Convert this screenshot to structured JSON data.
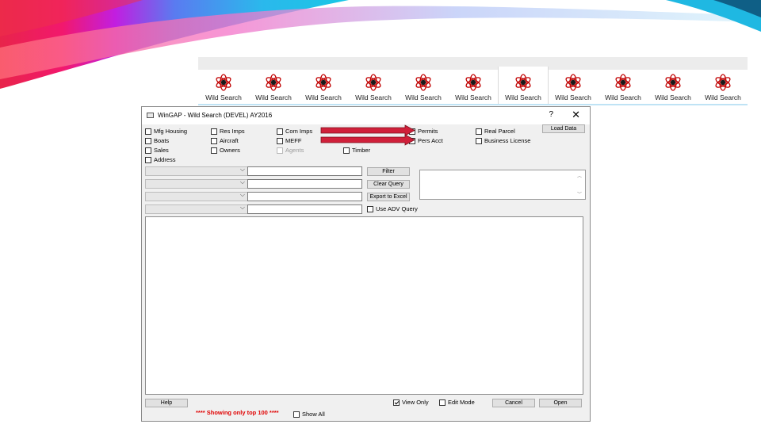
{
  "ribbon": {
    "tabs": [
      {
        "label": "Wild Search",
        "icon": "atom-icon"
      },
      {
        "label": "Wild Search",
        "icon": "atom-icon"
      },
      {
        "label": "Wild Search",
        "icon": "atom-icon"
      },
      {
        "label": "Wild Search",
        "icon": "atom-icon"
      },
      {
        "label": "Wild Search",
        "icon": "atom-icon"
      },
      {
        "label": "Wild Search",
        "icon": "atom-icon"
      },
      {
        "label": "Wild Search",
        "icon": "atom-icon",
        "active": true
      },
      {
        "label": "Wild Search",
        "icon": "atom-icon"
      },
      {
        "label": "Wild Search",
        "icon": "atom-icon"
      },
      {
        "label": "Wild Search",
        "icon": "atom-icon"
      },
      {
        "label": "Wild Search",
        "icon": "atom-icon"
      }
    ]
  },
  "window": {
    "title": "WinGAP - Wild Search (DEVEL) AY2016",
    "help_glyph": "?",
    "close_glyph": "✕",
    "checkboxes": {
      "mfg_housing": {
        "label": "Mfg Housing",
        "checked": false
      },
      "boats": {
        "label": "Boats",
        "checked": false
      },
      "sales": {
        "label": "Sales",
        "checked": false
      },
      "address": {
        "label": "Address",
        "checked": false
      },
      "res_imps": {
        "label": "Res Imps",
        "checked": false
      },
      "aircraft": {
        "label": "Aircraft",
        "checked": false
      },
      "owners": {
        "label": "Owners",
        "checked": false
      },
      "com_imps": {
        "label": "Com Imps",
        "checked": false
      },
      "meff": {
        "label": "MEFF",
        "checked": false
      },
      "agents": {
        "label": "Agents",
        "checked": false,
        "disabled": true
      },
      "timber": {
        "label": "Timber",
        "checked": false
      },
      "permits": {
        "label": "Permits",
        "checked": false
      },
      "pers_acct": {
        "label": "Pers Acct",
        "checked": false
      },
      "real_parcel": {
        "label": "Real Parcel",
        "checked": false
      },
      "business_license": {
        "label": "Business License",
        "checked": false
      }
    },
    "buttons": {
      "load_data": "Load Data",
      "filter": "Filter",
      "clear_query": "Clear Query",
      "export": "Export to Excel",
      "help": "Help",
      "cancel": "Cancel",
      "open": "Open"
    },
    "use_adv_query": {
      "label": "Use ADV Query",
      "checked": false
    },
    "query_rows": [
      {
        "field": "",
        "value": ""
      },
      {
        "field": "",
        "value": ""
      },
      {
        "field": "",
        "value": ""
      },
      {
        "field": "",
        "value": ""
      }
    ],
    "view_only": {
      "label": "View Only",
      "checked": true
    },
    "edit_mode": {
      "label": "Edit Mode",
      "checked": false
    },
    "status_message": "**** Showing only top 100 ****",
    "show_all": {
      "label": "Show All",
      "checked": false
    }
  },
  "annotations": {
    "arrow_color": "#d0203a",
    "arrows": [
      "points-to-permits",
      "points-to-pers-acct"
    ]
  },
  "theme": {
    "accent_pink": "#f2186d",
    "accent_cyan": "#21c3e8"
  }
}
